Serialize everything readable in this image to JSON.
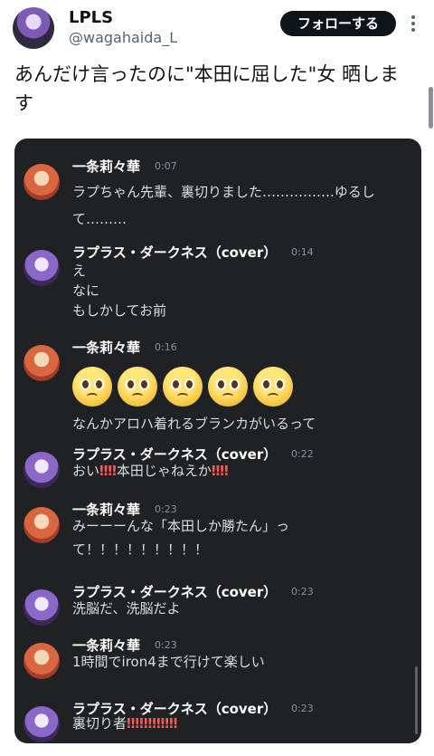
{
  "header": {
    "name": "LPLS",
    "handle": "@wagahaida_L",
    "follow_label": "フォローする"
  },
  "tweet": {
    "line1": "あんだけ言ったのに\"本田に屈した\"女 晒しま",
    "line2": "す"
  },
  "chat": {
    "messages": [
      {
        "author": "一条莉々華",
        "time": "0:07",
        "lines": [
          "ラプちゃん先輩、裏切りました…………….ゆるし",
          "て………"
        ]
      },
      {
        "author": "ラプラス・ダークネス（cover）",
        "time": "0:14",
        "lines": [
          "え",
          "なに",
          "もしかしてお前"
        ]
      },
      {
        "author": "一条莉々華",
        "time": "0:16",
        "emoji": "🥺🥺🥺🥺🥺",
        "lines": [
          "なんかアロハ着れるブランカがいるって"
        ]
      },
      {
        "author": "ラプラス・ダークネス（cover）",
        "time": "0:22",
        "text_prefix": "おい",
        "text_bang1": "‼‼",
        "text_middle": "本田じゃねえか",
        "text_bang2": "‼‼"
      },
      {
        "author": "一条莉々華",
        "time": "0:23",
        "lines": [
          "みーーーんな「本田しか勝たん」っ",
          "て！！！！！！！！！"
        ]
      },
      {
        "author": "ラプラス・ダークネス（cover）",
        "time": "0:23",
        "lines": [
          "洗脳だ、洗脳だよ"
        ]
      },
      {
        "author": "一条莉々華",
        "time": "0:23",
        "lines": [
          "1時間でiron4まで行けて楽しい"
        ]
      },
      {
        "author": "ラプラス・ダークネス（cover）",
        "time": "0:23",
        "text_prefix": "裏切り者",
        "text_bang": "‼‼‼‼‼‼"
      }
    ]
  }
}
